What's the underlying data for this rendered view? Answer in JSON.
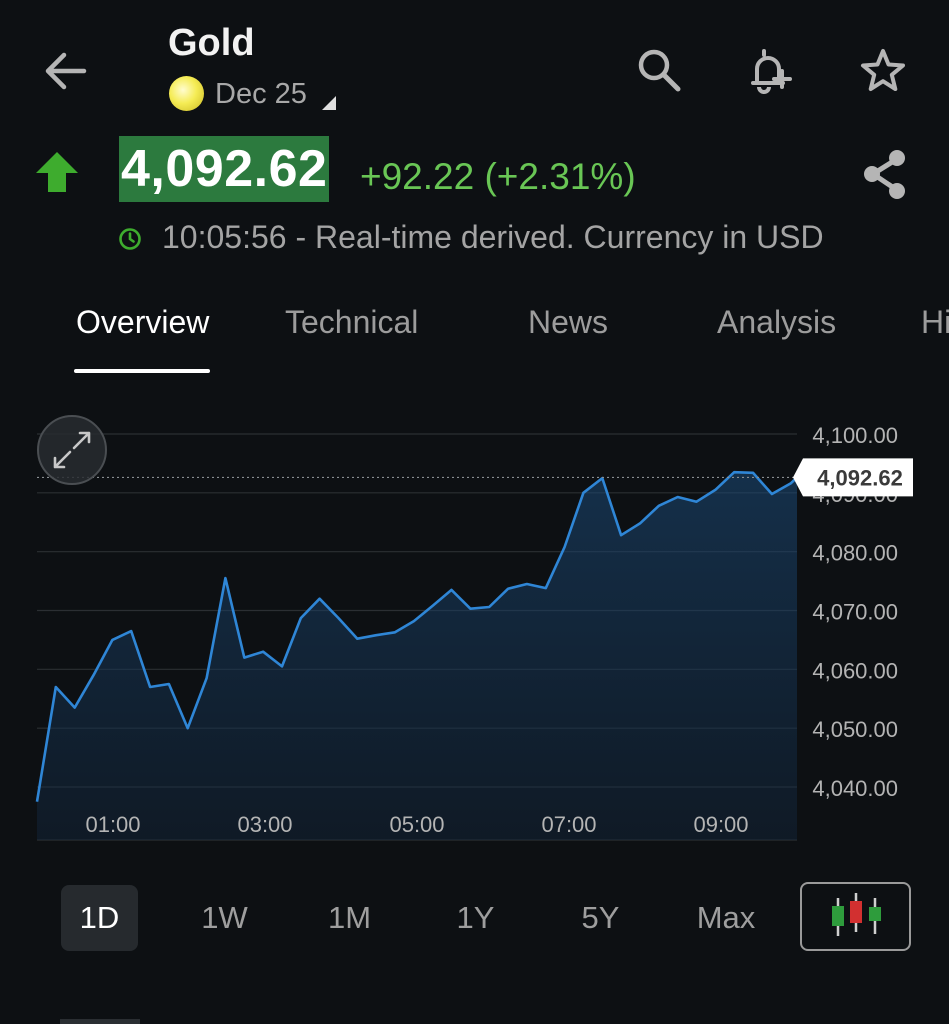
{
  "header": {
    "title": "Gold",
    "contract": "Dec 25"
  },
  "quote": {
    "price": "4,092.62",
    "change": "+92.22 (+2.31%)",
    "timestamp_line": "10:05:56 - Real-time derived. Currency in USD",
    "direction": "up",
    "up_color": "#69c655",
    "price_highlight": "#2c7a3e"
  },
  "tabs": [
    {
      "label": "Overview",
      "active": true
    },
    {
      "label": "Technical",
      "active": false
    },
    {
      "label": "News",
      "active": false
    },
    {
      "label": "Analysis",
      "active": false
    },
    {
      "label": "Hi",
      "active": false
    }
  ],
  "chart_data": {
    "type": "area",
    "y_ticks": [
      "4,100.00",
      "4,090.00",
      "4,080.00",
      "4,070.00",
      "4,060.00",
      "4,050.00",
      "4,040.00"
    ],
    "x_ticks": [
      "01:00",
      "03:00",
      "05:00",
      "07:00",
      "09:00"
    ],
    "ylim": [
      4035,
      4106
    ],
    "current_label": "4,092.62",
    "current_value": 4092.62,
    "line_color": "#2f86d6",
    "x": [
      "00:00",
      "00:15",
      "00:30",
      "00:45",
      "01:00",
      "01:15",
      "01:30",
      "01:45",
      "02:00",
      "02:15",
      "02:30",
      "02:45",
      "03:00",
      "03:15",
      "03:30",
      "03:45",
      "04:00",
      "04:15",
      "04:30",
      "04:45",
      "05:00",
      "05:15",
      "05:30",
      "05:45",
      "06:00",
      "06:15",
      "06:30",
      "06:45",
      "07:00",
      "07:15",
      "07:30",
      "07:45",
      "08:00",
      "08:15",
      "08:30",
      "08:45",
      "09:00",
      "09:15",
      "09:30",
      "09:45",
      "10:00",
      "10:05"
    ],
    "values": [
      4037.5,
      4057.0,
      4053.5,
      4059.0,
      4065.0,
      4066.5,
      4057.0,
      4057.5,
      4050.0,
      4058.5,
      4075.5,
      4062.0,
      4063.0,
      4060.5,
      4068.7,
      4072.0,
      4068.7,
      4065.2,
      4065.8,
      4066.3,
      4068.2,
      4070.8,
      4073.5,
      4070.3,
      4070.6,
      4073.7,
      4074.5,
      4073.8,
      4080.8,
      4090.0,
      4092.5,
      4082.8,
      4084.8,
      4087.8,
      4089.3,
      4088.5,
      4090.5,
      4093.5,
      4093.4,
      4089.8,
      4091.6,
      4092.62
    ]
  },
  "ranges": [
    {
      "label": "1D",
      "active": true
    },
    {
      "label": "1W",
      "active": false
    },
    {
      "label": "1M",
      "active": false
    },
    {
      "label": "1Y",
      "active": false
    },
    {
      "label": "5Y",
      "active": false
    },
    {
      "label": "Max",
      "active": false
    }
  ],
  "icons": {
    "back": "arrow-left-icon",
    "search": "search-icon",
    "alert": "bell-plus-icon",
    "favorite": "star-icon",
    "share": "share-icon",
    "clock": "clock-icon",
    "expand": "expand-icon",
    "candlestick": "candlestick-icon"
  },
  "candle_colors": {
    "green": "#2e9c3c",
    "red": "#d23030"
  }
}
